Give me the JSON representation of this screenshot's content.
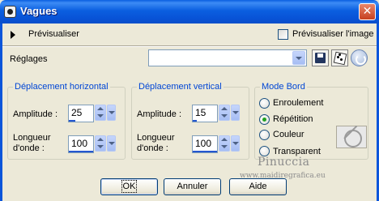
{
  "window": {
    "title": "Vagues",
    "close_symbol": "✕"
  },
  "preview": {
    "label": "Prévisualiser",
    "image_checkbox_label": "Prévisualiser l'image",
    "image_checked": false
  },
  "settings": {
    "label": "Réglages",
    "preset_value": ""
  },
  "horizontal": {
    "title": "Déplacement horizontal",
    "amplitude_label": "Amplitude :",
    "amplitude_value": "25",
    "amplitude_fill": 0.25,
    "wavelength_label_1": "Longueur",
    "wavelength_label_2": "d'onde :",
    "wavelength_value": "100",
    "wavelength_fill": 1.0
  },
  "vertical": {
    "title": "Déplacement vertical",
    "amplitude_label": "Amplitude :",
    "amplitude_value": "15",
    "amplitude_fill": 0.15,
    "wavelength_label_1": "Longueur",
    "wavelength_label_2": "d'onde :",
    "wavelength_value": "100",
    "wavelength_fill": 1.0
  },
  "edge_mode": {
    "title": "Mode Bord",
    "options": [
      "Enroulement",
      "Répétition",
      "Couleur",
      "Transparent"
    ],
    "selected": "Répétition"
  },
  "buttons": {
    "ok": "OK",
    "cancel": "Annuler",
    "help": "Aide"
  },
  "watermark": {
    "line1": "Pinuccia",
    "line2": "www.maidiregrafica.eu"
  },
  "icons": {
    "app": "app-icon",
    "close": "close-icon",
    "expand": "triangle-right-icon",
    "save": "floppy-disk-icon",
    "random": "dice-icon",
    "reset": "reset-icon",
    "no_color": "no-color-icon"
  }
}
